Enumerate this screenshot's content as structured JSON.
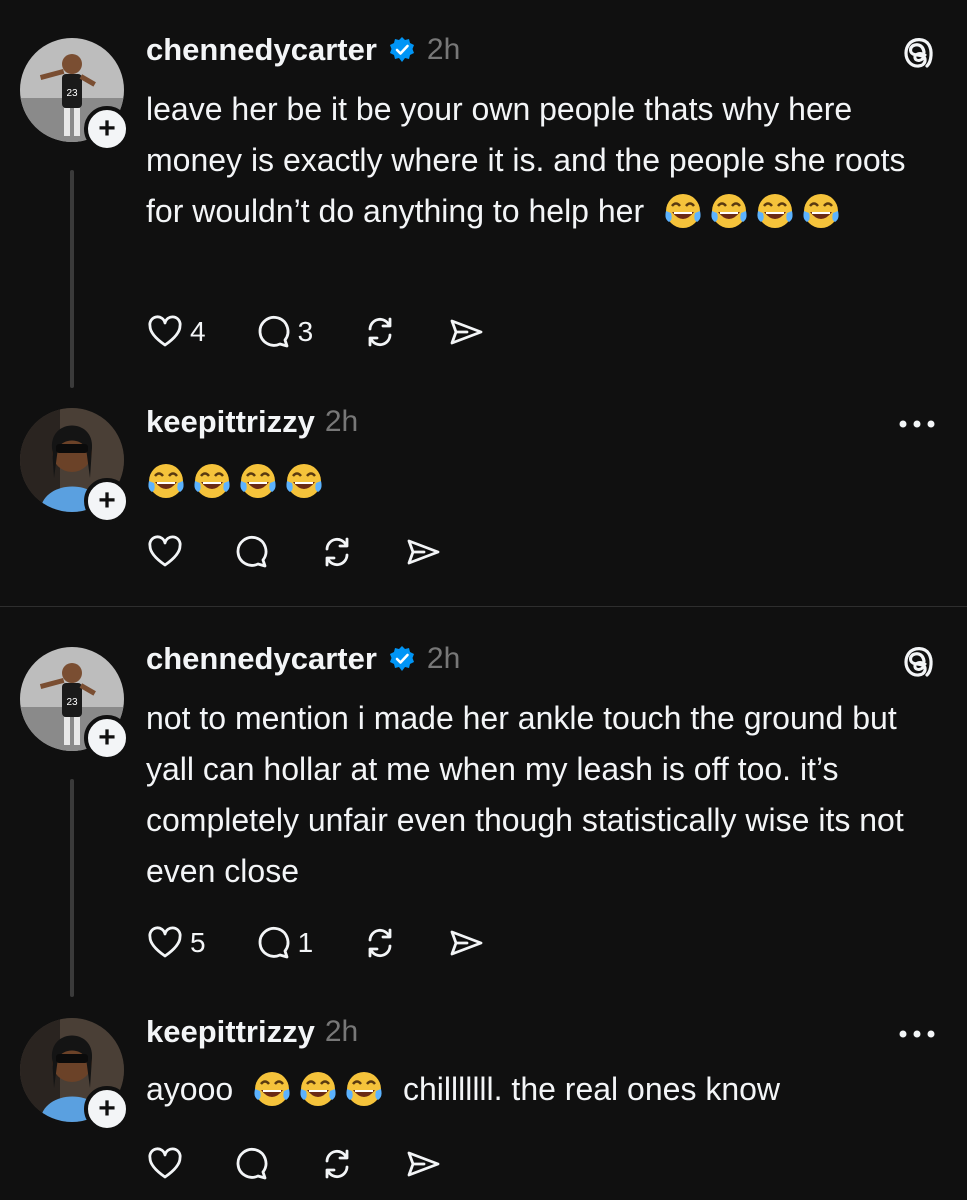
{
  "posts": [
    {
      "username": "chennedycarter",
      "verified": true,
      "time": "2h",
      "text": "leave her be it be your own people thats why here money is exactly where it is. and the people she roots for wouldn’t do anything to help her",
      "trailing_emoji_count": 4,
      "likes": "4",
      "replies": "3",
      "icon": "threads-logo-icon"
    },
    {
      "username": "keepittrizzy",
      "verified": false,
      "time": "2h",
      "text": "",
      "trailing_emoji_count": 4,
      "likes": "",
      "replies": "",
      "icon": "more-options-icon"
    },
    {
      "username": "chennedycarter",
      "verified": true,
      "time": "2h",
      "text": "not to mention i made her ankle touch the ground but yall can hollar at me when my leash is off too. it’s completely unfair even though statistically wise its not even close",
      "trailing_emoji_count": 0,
      "likes": "5",
      "replies": "1",
      "icon": "threads-logo-icon"
    },
    {
      "username": "keepittrizzy",
      "verified": false,
      "time": "2h",
      "text_before": "ayooo",
      "text_after": "chilllllll. the real ones know",
      "emoji_count": 3,
      "likes": "",
      "replies": "",
      "icon": "more-options-icon"
    }
  ],
  "colors": {
    "background": "#101010",
    "text": "#f3f5f7",
    "muted": "#777777",
    "verified_blue": "#0095f6",
    "thread_line": "#3a3a3a"
  }
}
